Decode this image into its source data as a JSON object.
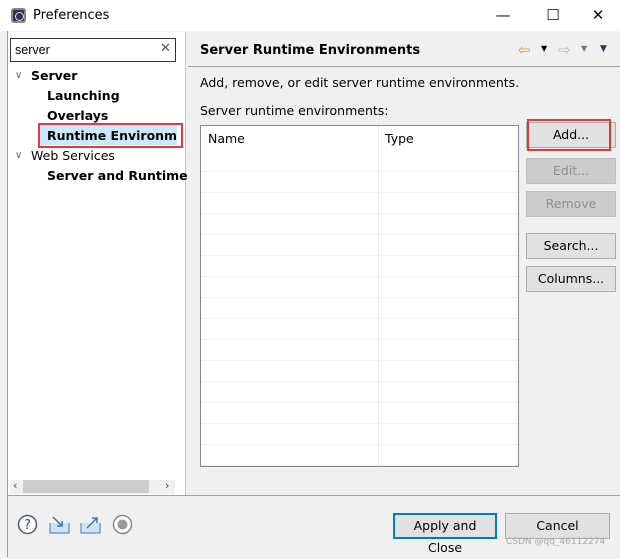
{
  "window": {
    "title": "Preferences",
    "minimize": "—",
    "maximize": "☐",
    "close": "✕"
  },
  "sidebar": {
    "search_value": "server",
    "tree": [
      {
        "label": "Server",
        "level": 0,
        "expanded": true,
        "bold": true
      },
      {
        "label": "Launching",
        "level": 1,
        "bold": true
      },
      {
        "label": "Overlays",
        "level": 1,
        "bold": true
      },
      {
        "label": "Runtime Environmen",
        "level": 1,
        "bold": true,
        "selected": true
      },
      {
        "label": "Web Services",
        "level": 0,
        "expanded": true,
        "bold": false
      },
      {
        "label": "Server and Runtime",
        "level": 1,
        "bold": true
      }
    ]
  },
  "main": {
    "header": "Server Runtime Environments",
    "description": "Add, remove, or edit server runtime environments.",
    "list_label": "Server runtime environments:",
    "columns": [
      "Name",
      "Type"
    ],
    "rows": [],
    "buttons": {
      "add": "Add...",
      "edit": "Edit...",
      "remove": "Remove",
      "search": "Search...",
      "columns": "Columns..."
    }
  },
  "footer": {
    "apply_close": "Apply and Close",
    "cancel": "Cancel"
  },
  "watermark": "CSDN @qq_46112274",
  "colors": {
    "highlight": "#e53935",
    "selection": "#cce8ff",
    "default_button_border": "#0078d7"
  }
}
